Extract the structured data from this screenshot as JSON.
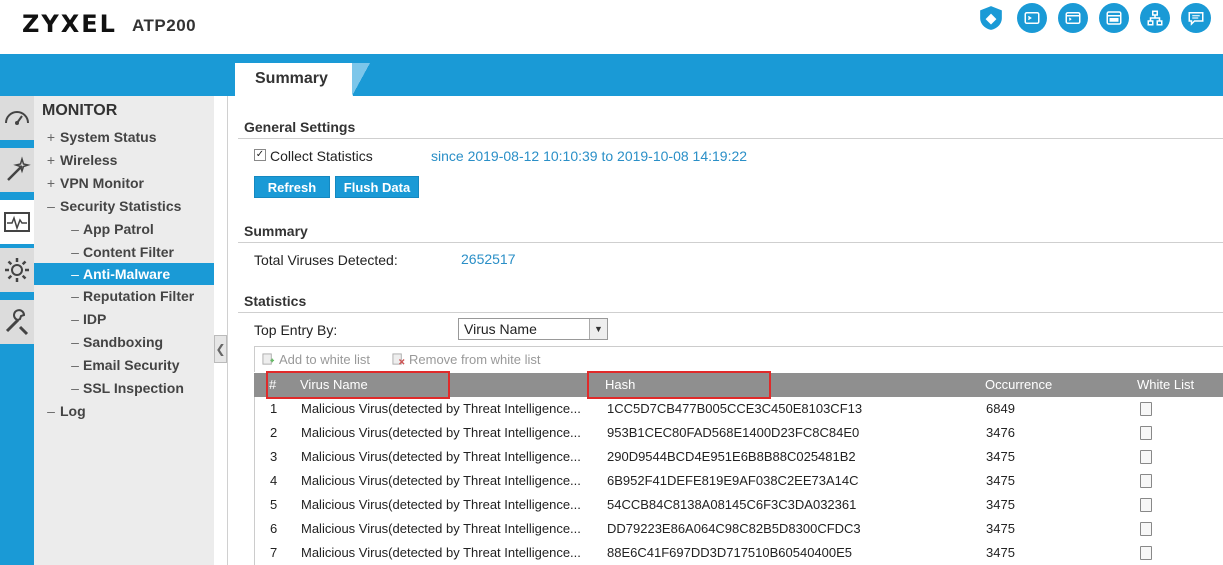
{
  "header": {
    "logo": "ZYXEL",
    "model": "ATP200",
    "icons": [
      "shield-icon",
      "console-icon",
      "cli-icon",
      "browser-icon",
      "network-map-icon",
      "chat-icon"
    ]
  },
  "tab": {
    "label": "Summary"
  },
  "sidebar": {
    "title": "MONITOR",
    "items": [
      {
        "sign": "+",
        "label": "System Status"
      },
      {
        "sign": "+",
        "label": "Wireless"
      },
      {
        "sign": "+",
        "label": "VPN Monitor"
      },
      {
        "sign": "–",
        "label": "Security Statistics"
      },
      {
        "sign": "–",
        "label": "App Patrol"
      },
      {
        "sign": "–",
        "label": "Content Filter"
      },
      {
        "sign": "–",
        "label": "Anti-Malware"
      },
      {
        "sign": "–",
        "label": "Reputation Filter"
      },
      {
        "sign": "–",
        "label": "IDP"
      },
      {
        "sign": "–",
        "label": "Sandboxing"
      },
      {
        "sign": "–",
        "label": "Email Security"
      },
      {
        "sign": "–",
        "label": "SSL Inspection"
      },
      {
        "sign": "–",
        "label": "Log"
      }
    ],
    "collapse_glyph": "❮"
  },
  "general": {
    "title": "General Settings",
    "collect_label": "Collect Statistics",
    "collect_checked": "✓",
    "since_text": "since 2019-08-12 10:10:39 to 2019-10-08 14:19:22",
    "refresh": "Refresh",
    "flush": "Flush Data"
  },
  "summary": {
    "title": "Summary",
    "total_label": "Total Viruses Detected:",
    "total_value": "2652517"
  },
  "statistics": {
    "title": "Statistics",
    "top_entry_label": "Top Entry By:",
    "top_entry_value": "Virus Name",
    "add_white": "Add to white list",
    "remove_white": "Remove from white list",
    "columns": [
      "#",
      "Virus Name",
      "Hash",
      "Occurrence",
      "White List"
    ],
    "rows": [
      {
        "num": "1",
        "name": "Malicious Virus(detected by Threat Intelligence...",
        "hash": "1CC5D7CB477B005CCE3C450E8103CF13",
        "occ": "6849"
      },
      {
        "num": "2",
        "name": "Malicious Virus(detected by Threat Intelligence...",
        "hash": "953B1CEC80FAD568E1400D23FC8C84E0",
        "occ": "3476"
      },
      {
        "num": "3",
        "name": "Malicious Virus(detected by Threat Intelligence...",
        "hash": "290D9544BCD4E951E6B8B88C025481B2",
        "occ": "3475"
      },
      {
        "num": "4",
        "name": "Malicious Virus(detected by Threat Intelligence...",
        "hash": "6B952F41DEFE819E9AF038C2EE73A14C",
        "occ": "3475"
      },
      {
        "num": "5",
        "name": "Malicious Virus(detected by Threat Intelligence...",
        "hash": "54CCB84C8138A08145C6F3C3DA032361",
        "occ": "3475"
      },
      {
        "num": "6",
        "name": "Malicious Virus(detected by Threat Intelligence...",
        "hash": "DD79223E86A064C98C82B5D8300CFDC3",
        "occ": "3475"
      },
      {
        "num": "7",
        "name": "Malicious Virus(detected by Threat Intelligence...",
        "hash": "88E6C41F697DD3D717510B60540400E5",
        "occ": "3475"
      }
    ]
  },
  "colors": {
    "accent": "#1a9ad6",
    "link": "#2a8fc7",
    "highlight": "#e02a2a",
    "table_header": "#8f8f8f",
    "sidebar_bg": "#ececec"
  }
}
